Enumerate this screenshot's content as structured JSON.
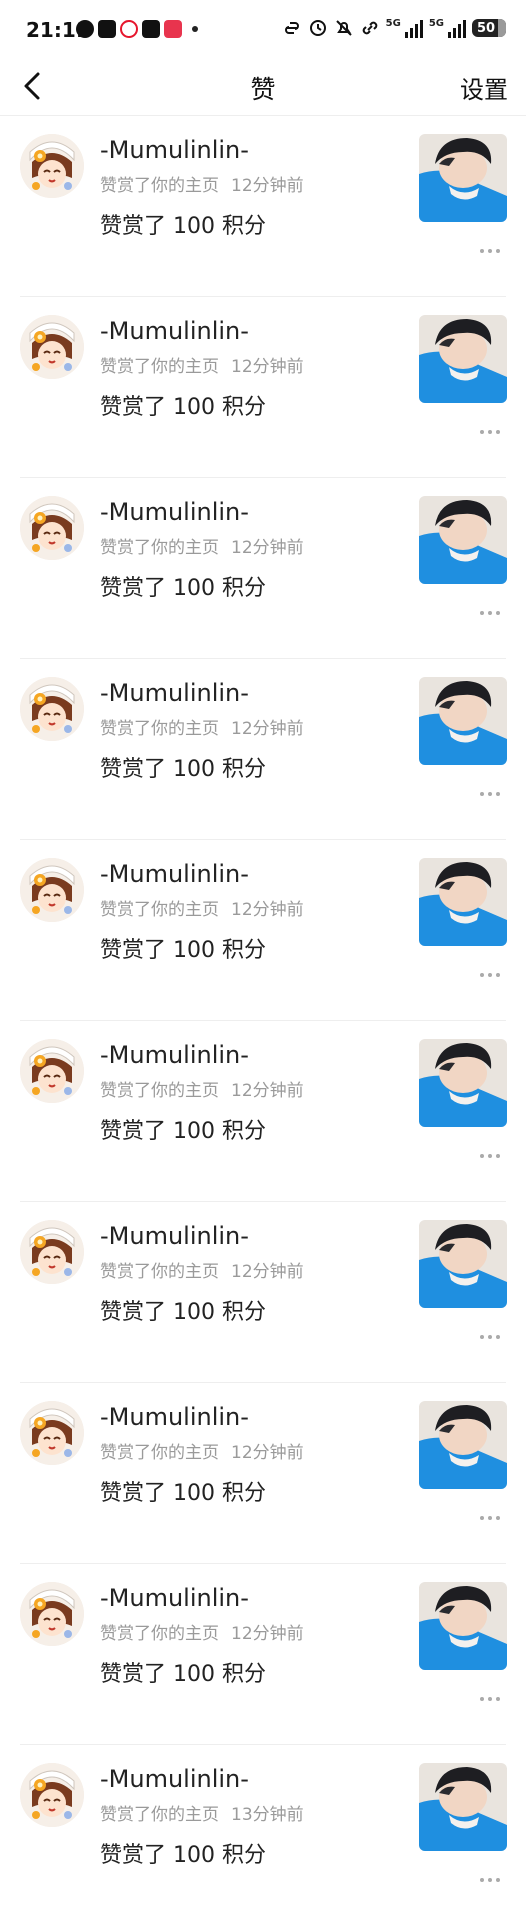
{
  "status_bar": {
    "time": "21:11",
    "network_1": "5G",
    "network_2": "5G",
    "battery": "50"
  },
  "header": {
    "title": "赞",
    "settings_label": "设置"
  },
  "notifications": [
    {
      "username": "-Mumulinlin-",
      "action": "赞赏了你的主页",
      "time": "12分钟前",
      "content": "赞赏了 100 积分"
    },
    {
      "username": "-Mumulinlin-",
      "action": "赞赏了你的主页",
      "time": "12分钟前",
      "content": "赞赏了 100 积分"
    },
    {
      "username": "-Mumulinlin-",
      "action": "赞赏了你的主页",
      "time": "12分钟前",
      "content": "赞赏了 100 积分"
    },
    {
      "username": "-Mumulinlin-",
      "action": "赞赏了你的主页",
      "time": "12分钟前",
      "content": "赞赏了 100 积分"
    },
    {
      "username": "-Mumulinlin-",
      "action": "赞赏了你的主页",
      "time": "12分钟前",
      "content": "赞赏了 100 积分"
    },
    {
      "username": "-Mumulinlin-",
      "action": "赞赏了你的主页",
      "time": "12分钟前",
      "content": "赞赏了 100 积分"
    },
    {
      "username": "-Mumulinlin-",
      "action": "赞赏了你的主页",
      "time": "12分钟前",
      "content": "赞赏了 100 积分"
    },
    {
      "username": "-Mumulinlin-",
      "action": "赞赏了你的主页",
      "time": "12分钟前",
      "content": "赞赏了 100 积分"
    },
    {
      "username": "-Mumulinlin-",
      "action": "赞赏了你的主页",
      "time": "12分钟前",
      "content": "赞赏了 100 积分"
    },
    {
      "username": "-Mumulinlin-",
      "action": "赞赏了你的主页",
      "time": "13分钟前",
      "content": "赞赏了 100 积分"
    }
  ],
  "colors": {
    "text_primary": "#222222",
    "text_secondary": "#9a9a9a",
    "divider": "#eeeeee",
    "thumb_shirt": "#1f8fe0"
  },
  "icons": [
    "back-arrow-icon",
    "more-icon",
    "wechat-icon",
    "tiktok-icon",
    "weibo-icon",
    "tiktok-lite-icon",
    "shop-icon",
    "alarm-icon",
    "mute-icon",
    "signal-icon"
  ]
}
